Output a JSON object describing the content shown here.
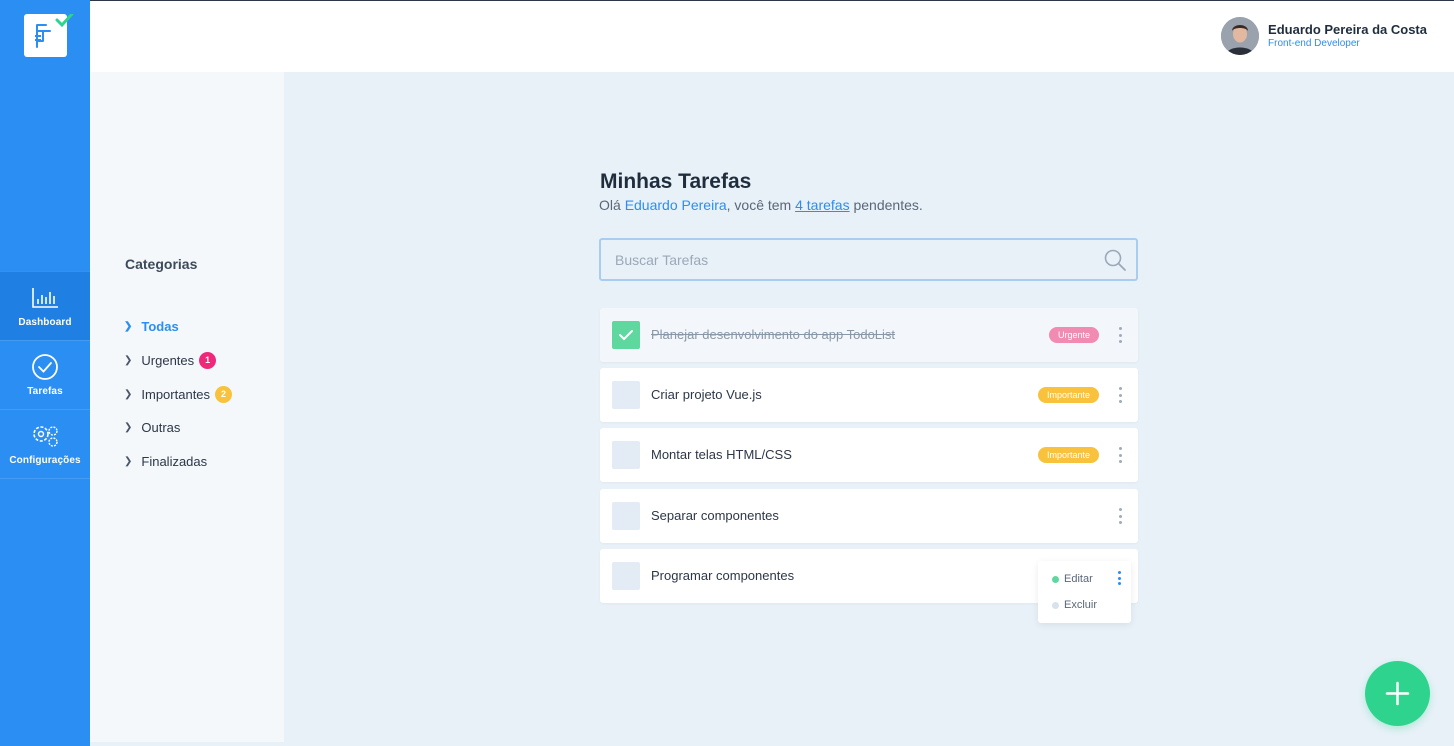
{
  "nav": {
    "items": [
      {
        "label": "Dashboard",
        "icon": "bar-chart-icon",
        "active": true
      },
      {
        "label": "Tarefas",
        "icon": "check-circle-icon",
        "active": false
      },
      {
        "label": "Configurações",
        "icon": "gears-icon",
        "active": false
      }
    ]
  },
  "user": {
    "name": "Eduardo Pereira da Costa",
    "role": "Front-end Developer"
  },
  "categories": {
    "title": "Categorias",
    "items": [
      {
        "label": "Todas",
        "active": true
      },
      {
        "label": "Urgentes",
        "badge": "1",
        "badge_color": "#f0287a"
      },
      {
        "label": "Importantes",
        "badge": "2",
        "badge_color": "#f9c23c"
      },
      {
        "label": "Outras"
      },
      {
        "label": "Finalizadas"
      }
    ]
  },
  "main": {
    "title": "Minhas Tarefas",
    "greeting_prefix": "Olá ",
    "greeting_name": "Eduardo Pereira",
    "greeting_middle": ", você tem ",
    "greeting_count": "4 tarefas",
    "greeting_suffix": " pendentes.",
    "search_placeholder": "Buscar Tarefas",
    "search_value": ""
  },
  "tasks": [
    {
      "title": "Planejar desenvolvimento do app TodoList",
      "done": true,
      "tag": "Urgente",
      "tag_color": "#f28bb2"
    },
    {
      "title": "Criar projeto Vue.js",
      "done": false,
      "tag": "Importante",
      "tag_color": "#f9c23c"
    },
    {
      "title": "Montar telas HTML/CSS",
      "done": false,
      "tag": "Importante",
      "tag_color": "#f9c23c"
    },
    {
      "title": "Separar componentes",
      "done": false,
      "tag": ""
    },
    {
      "title": "Programar componentes",
      "done": false,
      "tag": ""
    }
  ],
  "context_menu": {
    "edit_label": "Editar",
    "delete_label": "Excluir"
  },
  "colors": {
    "primary": "#2b8ef2",
    "success": "#2ed48e",
    "urgent": "#f0287a",
    "important": "#f9c23c"
  }
}
